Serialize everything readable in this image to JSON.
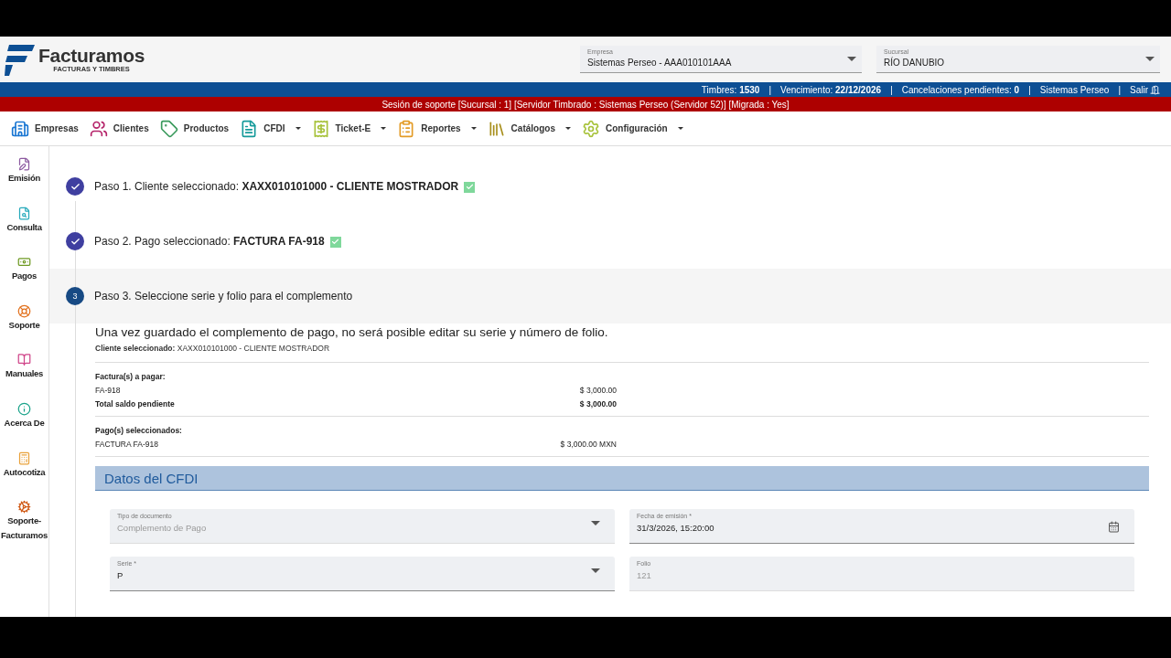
{
  "logo": {
    "name": "Facturamos",
    "tagline": "FACTURAS Y TIMBRES"
  },
  "selectors": [
    {
      "label": "Empresa",
      "value": "Sistemas Perseo - AAA010101AAA"
    },
    {
      "label": "Sucursal",
      "value": "RÍO DANUBIO"
    }
  ],
  "status_bar": {
    "items": [
      {
        "kind": "stat",
        "label": "Timbres:",
        "value": "1530"
      },
      {
        "kind": "divider",
        "text": "|"
      },
      {
        "kind": "stat",
        "label": "Vencimiento:",
        "value": "22/12/2026"
      },
      {
        "kind": "divider",
        "text": "|"
      },
      {
        "kind": "stat",
        "label": "Cancelaciones pendientes:",
        "value": "0"
      },
      {
        "kind": "divider",
        "text": "|"
      },
      {
        "kind": "link",
        "text": "Sistemas Perseo"
      },
      {
        "kind": "divider",
        "text": "|"
      },
      {
        "kind": "logout",
        "text": "Salir"
      }
    ]
  },
  "support_banner": "Sesión de soporte [Sucursal : 1] [Servidor Timbrado : Sistemas Perseo (Servidor 52)] [Migrada : Yes]",
  "menu": [
    {
      "label": "Empresas",
      "dropdown": false
    },
    {
      "label": "Clientes",
      "dropdown": false
    },
    {
      "label": "Productos",
      "dropdown": false
    },
    {
      "label": "CFDI",
      "dropdown": true
    },
    {
      "label": "Ticket-E",
      "dropdown": true
    },
    {
      "label": "Reportes",
      "dropdown": true
    },
    {
      "label": "Catálogos",
      "dropdown": true
    },
    {
      "label": "Configuración",
      "dropdown": true
    }
  ],
  "sidebar": {
    "items": [
      {
        "label": "Emisión"
      },
      {
        "label": "Consulta"
      },
      {
        "label": "Pagos"
      },
      {
        "label": "Soporte"
      },
      {
        "label": "Manuales"
      },
      {
        "label": "Acerca De"
      },
      {
        "label": "Autocotiza"
      },
      {
        "label": "Soporte-Facturamos"
      }
    ]
  },
  "steps": [
    {
      "completed": true,
      "selected": false,
      "text": "Paso 1. Cliente seleccionado: **XAXX010101000 - CLIENTE MOSTRADOR**",
      "verified": true
    },
    {
      "completed": true,
      "selected": false,
      "text": "Paso 2. Pago seleccionado: **FACTURA FA-918**",
      "verified": true
    },
    {
      "completed": false,
      "selected": true,
      "number": "3",
      "text": "Paso 3. Seleccione serie y folio para el complemento",
      "verified": false
    }
  ],
  "notice": "Una vez guardado el complemento de pago, no será posible editar su serie y número de folio.",
  "client_line": {
    "label": "Cliente seleccionado:",
    "value": "XAXX010101000 - CLIENTE MOSTRADOR"
  },
  "invoices": {
    "heading": "Factura(s) a pagar:",
    "rows": [
      {
        "kind": "item",
        "label": "FA-918",
        "amount": "$ 3,000.00"
      },
      {
        "kind": "total",
        "label": "Total saldo pendiente",
        "amount": "$ 3,000.00"
      }
    ]
  },
  "payments": {
    "heading": "Pago(s) seleccionados:",
    "rows": [
      {
        "label": "FACTURA FA-918",
        "amount": "$ 3,000.00 MXN"
      }
    ]
  },
  "section_title": "Datos del CFDI",
  "fields": [
    {
      "kind": "select",
      "label": "Tipo de documento",
      "value": "Complemento de Pago",
      "disabled": true
    },
    {
      "kind": "date",
      "label": "Fecha de emisión *",
      "value": "31/3/2026, 15:20:00",
      "disabled": false
    },
    {
      "kind": "select",
      "label": "Serie *",
      "value": "P",
      "disabled": false
    },
    {
      "kind": "text",
      "label": "Folio",
      "value": "121",
      "disabled": true
    }
  ]
}
